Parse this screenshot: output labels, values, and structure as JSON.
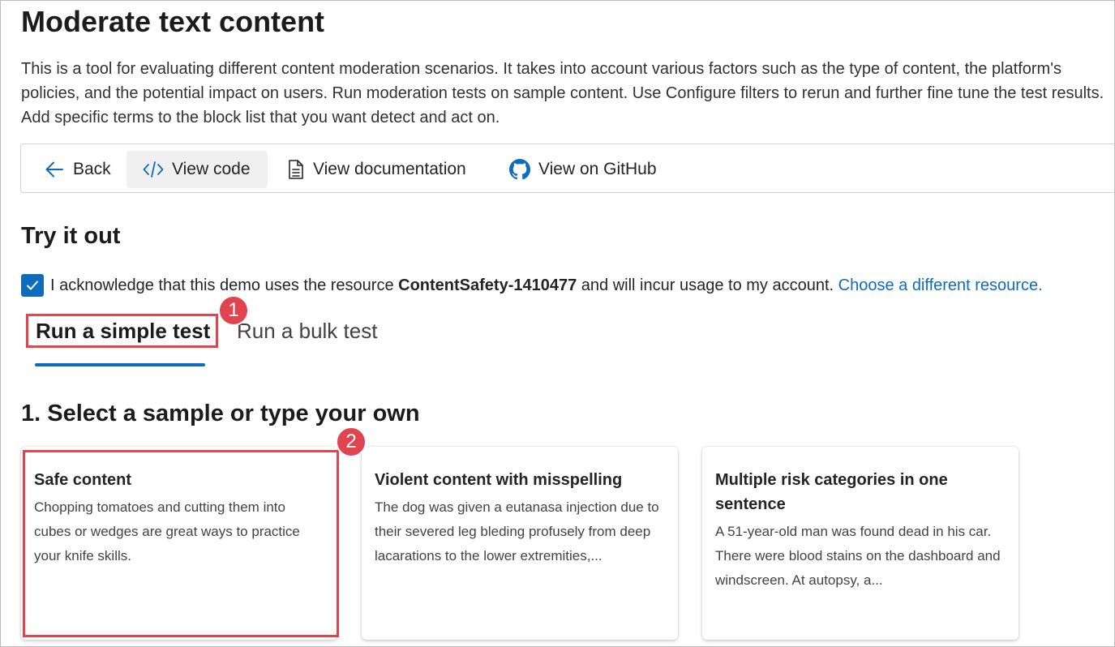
{
  "page": {
    "title": "Moderate text content",
    "description": "This is a tool for evaluating different content moderation scenarios. It takes into account various factors such as the type of content, the platform's policies, and the potential impact on users. Run moderation tests on sample content. Use Configure filters to rerun and further fine tune the test results. Add specific terms to the block list that you want detect and act on."
  },
  "toolbar": {
    "back_label": "Back",
    "view_code_label": "View code",
    "view_documentation_label": "View documentation",
    "view_github_label": "View on GitHub"
  },
  "try_it_out": {
    "heading": "Try it out",
    "ack_checked": true,
    "ack_prefix": "I acknowledge that this demo uses the resource",
    "resource_name": "ContentSafety-1410477",
    "ack_suffix": "and will incur usage to my account.",
    "change_resource_link": "Choose a different resource."
  },
  "tabs": [
    {
      "label": "Run a simple test",
      "selected": true
    },
    {
      "label": "Run a bulk test",
      "selected": false
    }
  ],
  "callouts": {
    "one": "1",
    "two": "2"
  },
  "step1": {
    "heading": "1. Select a sample or type your own",
    "samples": [
      {
        "title": "Safe content",
        "text": "Chopping tomatoes and cutting them into cubes or wedges are great ways to practice your knife skills."
      },
      {
        "title": "Violent content with misspelling",
        "text": "The dog was given a eutanasa injection due to their severed leg bleding profusely from deep lacarations to the lower extremities,..."
      },
      {
        "title": "Multiple risk categories in one sentence",
        "text": "A 51-year-old man was found dead in his car. There were blood stains on the dashboard and windscreen. At autopsy, a..."
      }
    ]
  },
  "colors": {
    "accent": "#0f6cbd",
    "highlight": "#e0454f"
  }
}
